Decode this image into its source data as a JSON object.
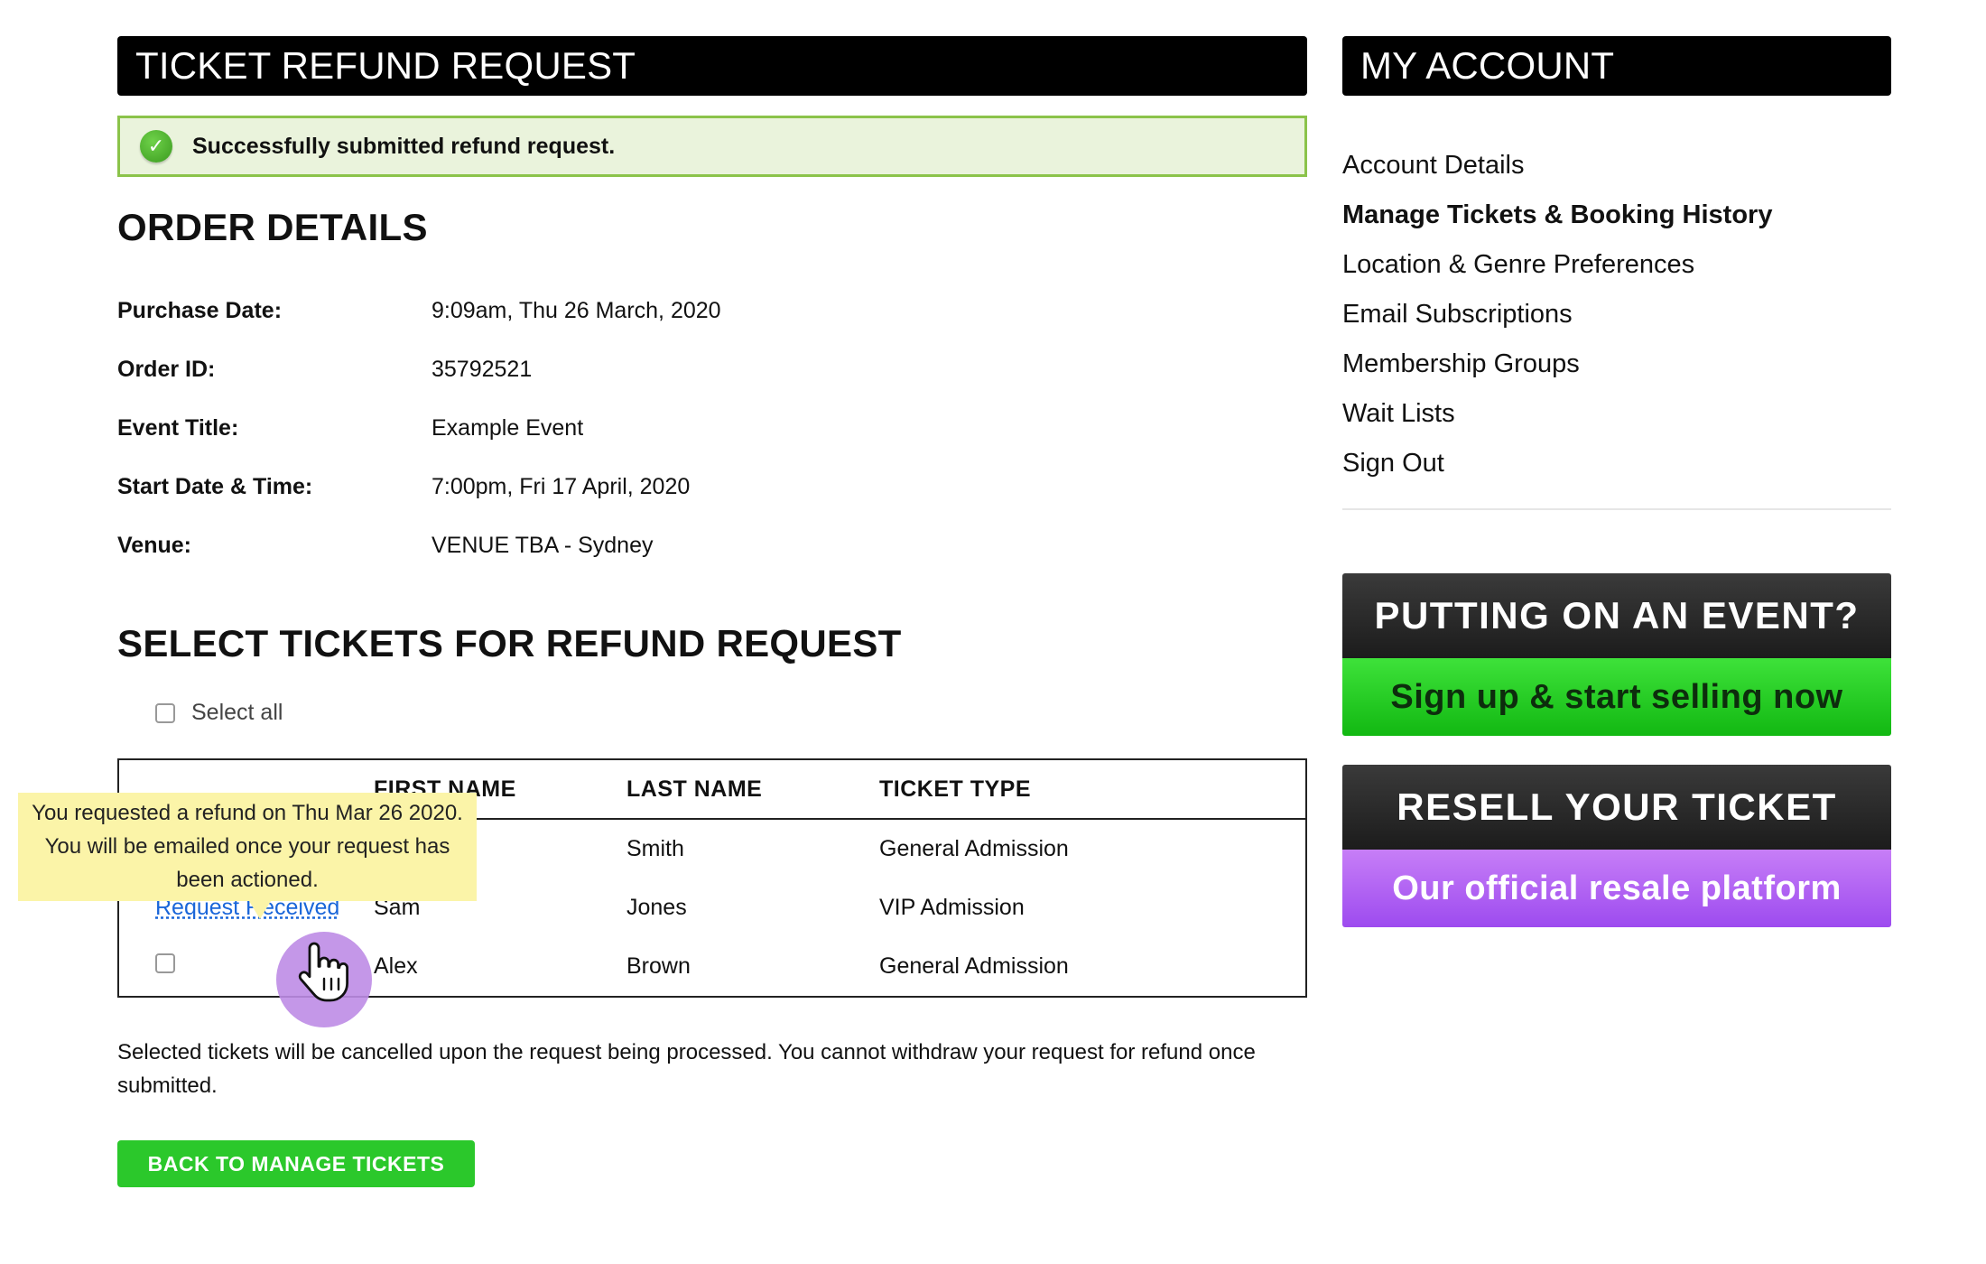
{
  "main": {
    "title": "TICKET REFUND REQUEST",
    "success_message": "Successfully submitted refund request.",
    "order_heading": "ORDER DETAILS",
    "order_details": [
      {
        "label": "Purchase Date:",
        "value": "9:09am, Thu 26 March, 2020"
      },
      {
        "label": "Order ID:",
        "value": "35792521"
      },
      {
        "label": "Event Title:",
        "value": "Example Event"
      },
      {
        "label": "Start Date & Time:",
        "value": "7:00pm, Fri 17 April, 2020"
      },
      {
        "label": "Venue:",
        "value": "VENUE TBA - Sydney"
      }
    ],
    "select_heading": "SELECT TICKETS FOR REFUND REQUEST",
    "select_all_label": "Select all",
    "table": {
      "columns": [
        "FIRST NAME",
        "LAST NAME",
        "TICKET TYPE"
      ],
      "rows": [
        {
          "status": "",
          "first": "",
          "last": "Smith",
          "type": "General Admission"
        },
        {
          "status": "Request Received",
          "first": "Sam",
          "last": "Jones",
          "type": "VIP Admission"
        },
        {
          "status": "",
          "first": "Alex",
          "last": "Brown",
          "type": "General Admission"
        }
      ]
    },
    "tooltip_text": "You requested a refund on Thu Mar 26 2020. You will be emailed once your request has been actioned.",
    "note": "Selected tickets will be cancelled upon the request being processed. You cannot withdraw your request for refund once submitted.",
    "back_button": "BACK TO MANAGE TICKETS"
  },
  "sidebar": {
    "title": "MY ACCOUNT",
    "menu": [
      {
        "label": "Account Details"
      },
      {
        "label": "Manage Tickets & Booking History"
      },
      {
        "label": "Location & Genre Preferences"
      },
      {
        "label": "Email Subscriptions"
      },
      {
        "label": "Membership Groups"
      },
      {
        "label": "Wait Lists"
      },
      {
        "label": "Sign Out"
      }
    ],
    "promo_event": {
      "top": "PUTTING ON AN EVENT?",
      "bottom": "Sign up & start selling now"
    },
    "promo_resell": {
      "top": "RESELL YOUR TICKET",
      "bottom": "Our official resale platform"
    }
  },
  "colors": {
    "success_border": "#8bc34a",
    "button_green": "#2bc82b",
    "link_blue": "#1a66d9",
    "tooltip_yellow": "#fbf4a8",
    "promo_purple": "#9d4bef"
  }
}
